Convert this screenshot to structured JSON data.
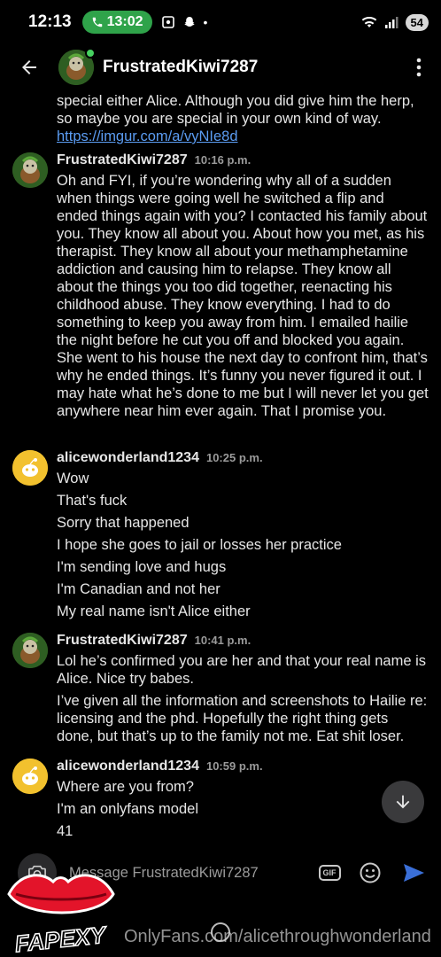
{
  "status_bar": {
    "time": "12:13",
    "call_time": "13:02",
    "battery": "54"
  },
  "header": {
    "title": "FrustratedKiwi7287"
  },
  "previous_message": {
    "text": "special either Alice. Although you did give him the herp, so maybe you are special in your own kind of way.",
    "link": "https://imgur.com/a/vyNIe8d"
  },
  "messages": [
    {
      "username": "FrustratedKiwi7287",
      "time": "10:16 p.m.",
      "avatar": "kiwi-avatar",
      "lines": [
        "Oh and FYI, if you’re wondering why all of a sudden when things were going well he switched a flip and ended things again with you? I contacted his family about you. They know all about you. About how you met, as his therapist. They know all about your methamphetamine addiction and causing him to relapse. They know all about the things you too did together, reenacting his childhood abuse. They know everything. I had to do something to keep you away from him. I emailed hailie the night before he cut you off and blocked you again. She went to his house the next day to confront him, that’s why he ended things. It’s funny you never figured it out. I may hate what he’s done to me but I will never let you get anywhere near him ever again. That I promise you."
      ]
    },
    {
      "username": "alicewonderland1234",
      "time": "10:25 p.m.",
      "avatar": "alice-avatar",
      "lines": [
        "Wow",
        "That's fuck",
        "Sorry that happened",
        "I hope she goes to jail or losses her practice",
        "I'm sending love and hugs",
        "I'm Canadian and not her",
        "My real name isn't Alice either"
      ]
    },
    {
      "username": "FrustratedKiwi7287",
      "time": "10:41 p.m.",
      "avatar": "kiwi-avatar",
      "lines": [
        "Lol he’s confirmed you are her and that your real name is Alice. Nice try babes.",
        "I’ve given all the information and screenshots to Hailie re: licensing and the phd. Hopefully the right thing gets done, but that’s up to the family not me. Eat shit loser."
      ]
    },
    {
      "username": "alicewonderland1234",
      "time": "10:59 p.m.",
      "avatar": "alice-avatar",
      "lines": [
        "Where are you from?",
        "I'm an onlyfans model",
        "41"
      ]
    }
  ],
  "composer": {
    "placeholder": "Message FrustratedKiwi7287",
    "gif_label": "GIF"
  },
  "watermark": {
    "logo_text": "FAPEXY",
    "text": "OnlyFans.com/alicethroughwonderland"
  },
  "colors": {
    "background": "#000000",
    "link": "#5b9cf2",
    "send": "#3a6fd8",
    "online": "#46d160",
    "call_pill": "#2fa34a"
  }
}
